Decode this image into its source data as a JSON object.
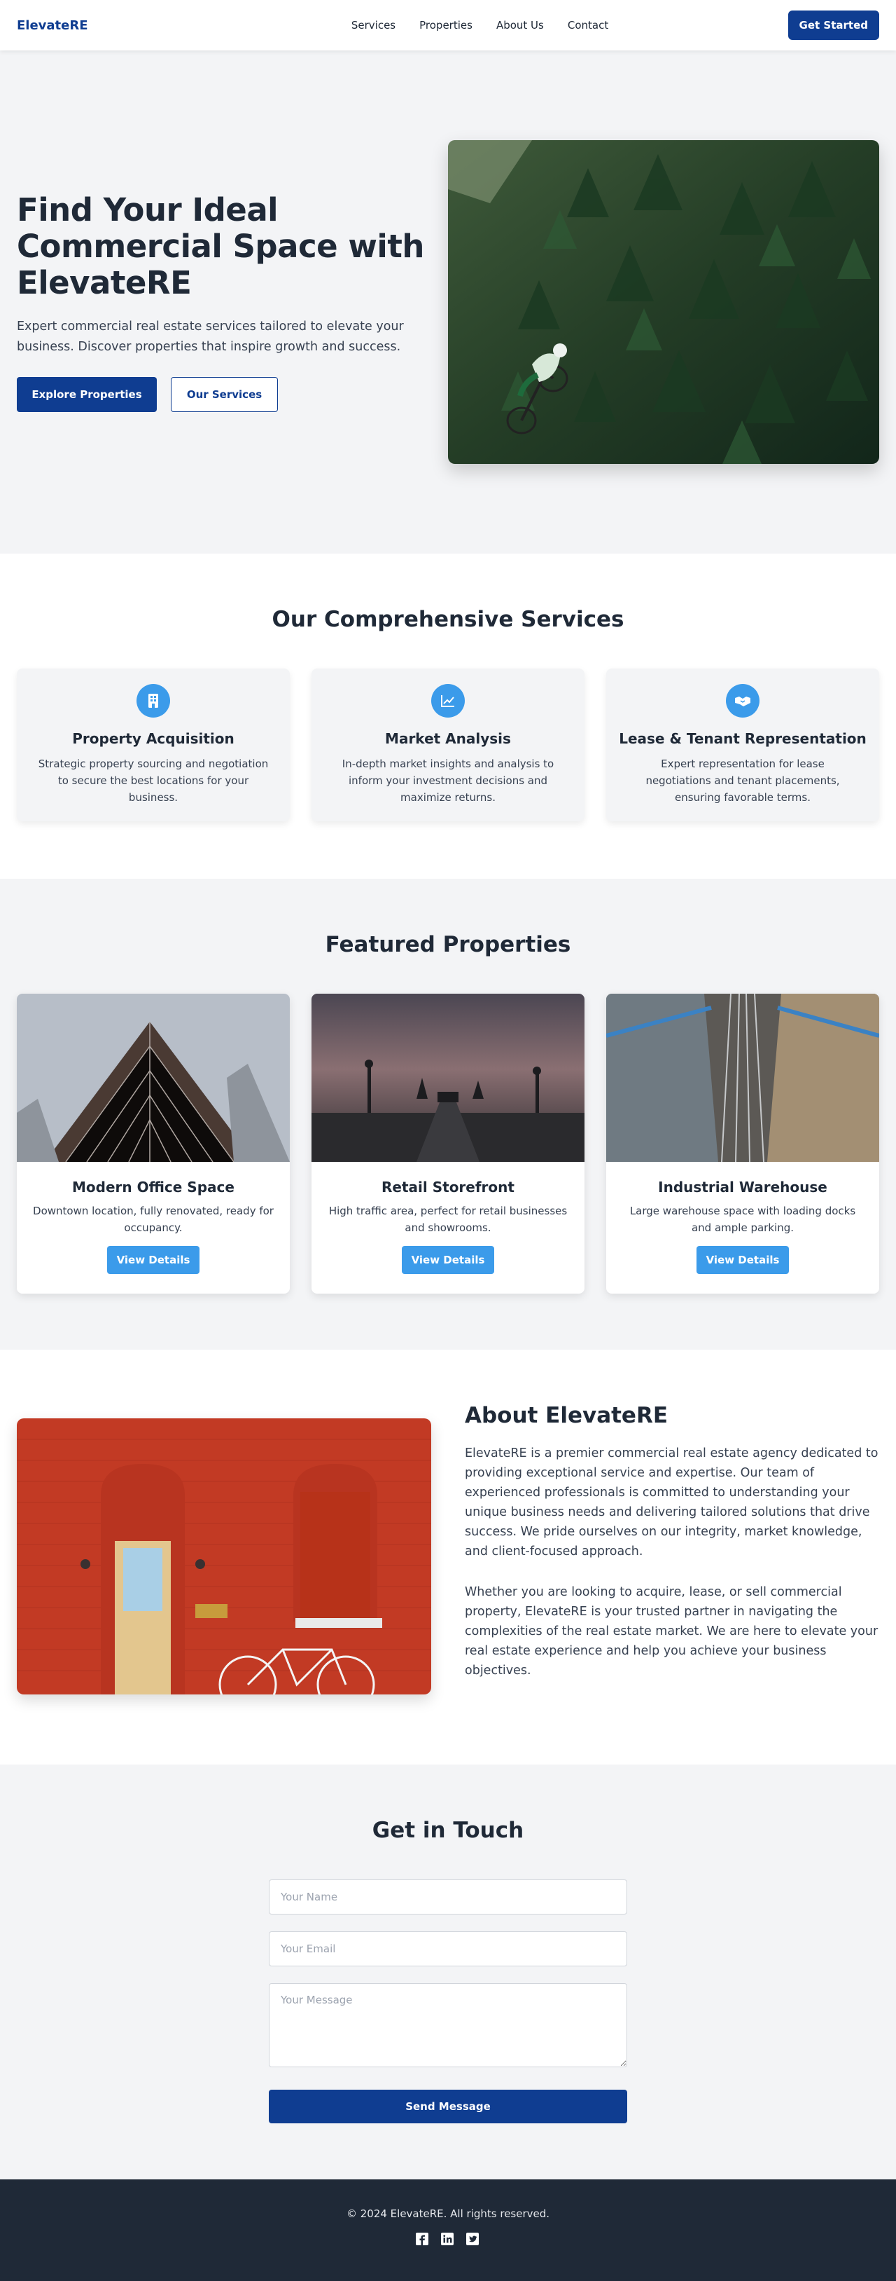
{
  "header": {
    "logo": "ElevateRE",
    "nav": [
      "Services",
      "Properties",
      "About Us",
      "Contact"
    ],
    "cta": "Get Started"
  },
  "hero": {
    "title": "Find Your Ideal Commercial Space with ElevateRE",
    "subtitle": "Expert commercial real estate services tailored to elevate your business. Discover properties that inspire growth and success.",
    "primary_button": "Explore Properties",
    "secondary_button": "Our Services"
  },
  "services": {
    "title": "Our Comprehensive Services",
    "items": [
      {
        "icon": "building-icon",
        "title": "Property Acquisition",
        "desc": "Strategic property sourcing and negotiation to secure the best locations for your business."
      },
      {
        "icon": "chart-line-icon",
        "title": "Market Analysis",
        "desc": "In-depth market insights and analysis to inform your investment decisions and maximize returns."
      },
      {
        "icon": "handshake-icon",
        "title": "Lease & Tenant Representation",
        "desc": "Expert representation for lease negotiations and tenant placements, ensuring favorable terms."
      }
    ]
  },
  "featured": {
    "title": "Featured Properties",
    "items": [
      {
        "title": "Modern Office Space",
        "desc": "Downtown location, fully renovated, ready for occupancy.",
        "button": "View Details"
      },
      {
        "title": "Retail Storefront",
        "desc": "High traffic area, perfect for retail businesses and showrooms.",
        "button": "View Details"
      },
      {
        "title": "Industrial Warehouse",
        "desc": "Large warehouse space with loading docks and ample parking.",
        "button": "View Details"
      }
    ]
  },
  "about": {
    "title": "About ElevateRE",
    "p1": "ElevateRE is a premier commercial real estate agency dedicated to providing exceptional service and expertise. Our team of experienced professionals is committed to understanding your unique business needs and delivering tailored solutions that drive success. We pride ourselves on our integrity, market knowledge, and client-focused approach.",
    "p2": "Whether you are looking to acquire, lease, or sell commercial property, ElevateRE is your trusted partner in navigating the complexities of the real estate market. We are here to elevate your real estate experience and help you achieve your business objectives."
  },
  "contact": {
    "title": "Get in Touch",
    "name_placeholder": "Your Name",
    "email_placeholder": "Your Email",
    "message_placeholder": "Your Message",
    "submit": "Send Message"
  },
  "footer": {
    "copyright": "© 2024 ElevateRE. All rights reserved.",
    "socials": [
      "facebook-icon",
      "linkedin-icon",
      "twitter-icon"
    ]
  },
  "colors": {
    "brand": "#0f3d91",
    "accent": "#3b9bea",
    "footer": "#1f2937",
    "section_bg": "#f3f4f6"
  }
}
